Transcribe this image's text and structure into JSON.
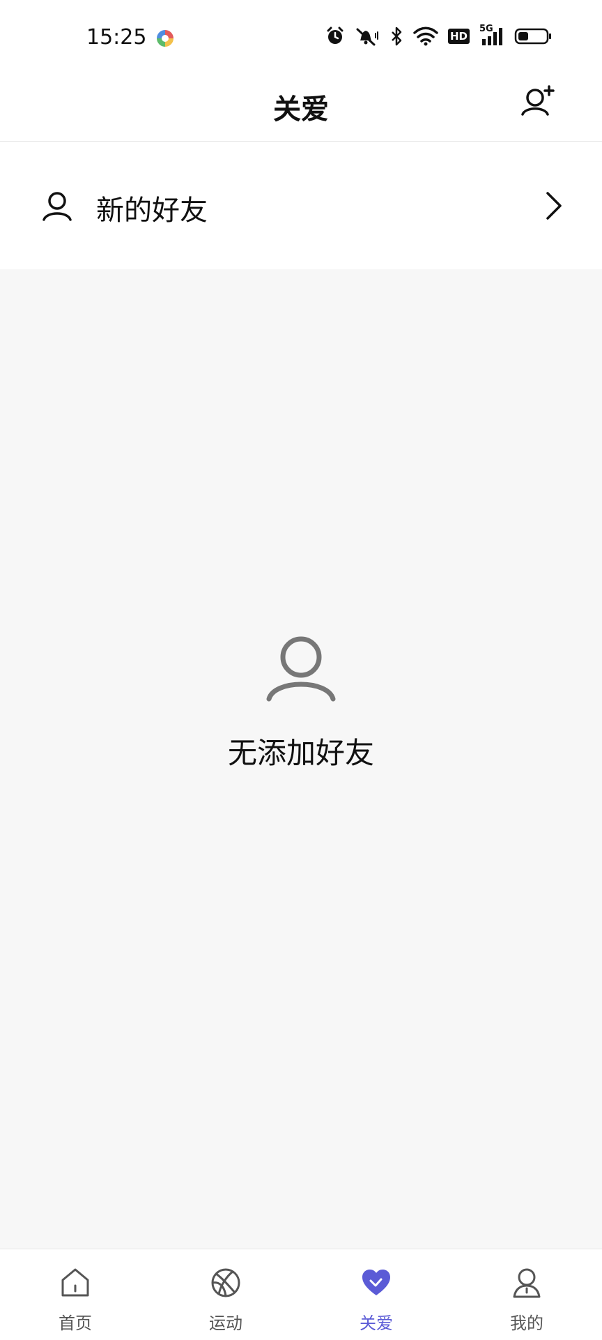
{
  "status_bar": {
    "time": "15:25",
    "icons": [
      "alarm-icon",
      "mute-icon",
      "bluetooth-icon",
      "wifi-icon",
      "hd-icon",
      "signal-5g-icon",
      "battery-icon"
    ],
    "hd_label": "HD",
    "network_label": "5G"
  },
  "header": {
    "title": "关爱",
    "action_icon": "add-user-icon"
  },
  "new_friends": {
    "label": "新的好友",
    "icon": "user-icon"
  },
  "empty_state": {
    "text": "无添加好友",
    "icon": "user-icon"
  },
  "tabs": [
    {
      "label": "首页",
      "icon": "home-icon",
      "active": false
    },
    {
      "label": "运动",
      "icon": "basketball-icon",
      "active": false
    },
    {
      "label": "关爱",
      "icon": "heart-icon",
      "active": true
    },
    {
      "label": "我的",
      "icon": "profile-icon",
      "active": false
    }
  ],
  "colors": {
    "accent": "#5b5bd6",
    "background": "#f7f7f7",
    "text": "#111111",
    "inactive_tab": "#555555"
  }
}
